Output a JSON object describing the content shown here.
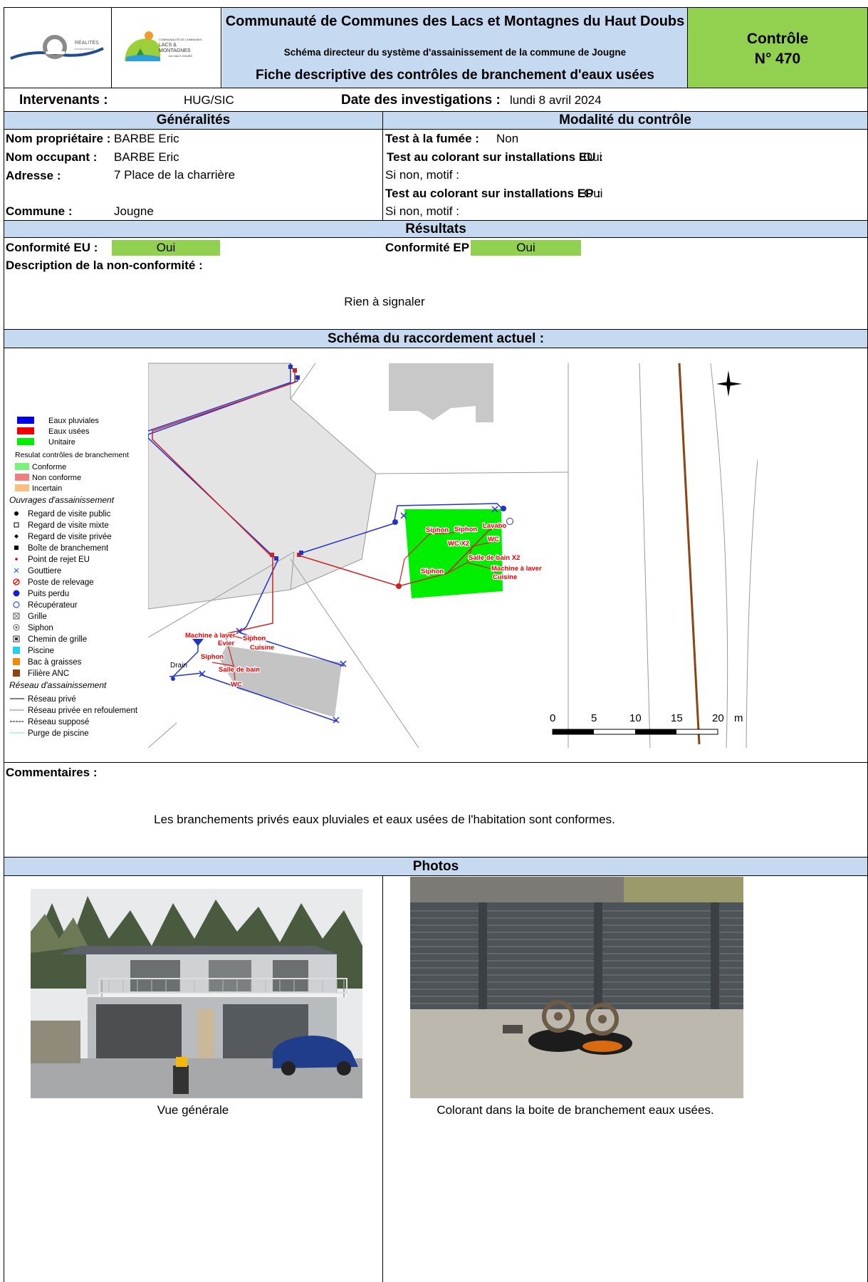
{
  "header": {
    "logo1_text": "RÉALITÉS",
    "logo1_sub": "Environnement",
    "logo2_lines": [
      "COMMUNAUTÉ DE COMMUNES",
      "LACS &",
      "MONTAGNES",
      "DU HAUT-DOUBS"
    ],
    "org_title": "Communauté de Communes des Lacs et Montagnes du Haut Doubs",
    "subtitle": "Schéma directeur du système d'assainissement de la commune de Jougne",
    "form_title": "Fiche descriptive des contrôles de branchement d'eaux usées",
    "control_label": "Contrôle",
    "control_number": "N° 470",
    "colors": {
      "blue_light": "#c5d9f1",
      "blue_bar": "#8db3e2",
      "green": "#92d050"
    }
  },
  "info": {
    "intervenants_label": "Intervenants :",
    "intervenants_value": "HUG/SIC",
    "date_label": "Date des investigations :",
    "date_value": "lundi 8 avril 2024"
  },
  "generalites": {
    "heading": "Généralités",
    "owner_label": "Nom propriétaire :",
    "owner_value": "BARBE Eric",
    "occupant_label": "Nom occupant :",
    "occupant_value": "BARBE Eric",
    "address_label": "Adresse :",
    "address_value": "7 Place de la charrière",
    "commune_label": "Commune :",
    "commune_value": "Jougne"
  },
  "modalite": {
    "heading": "Modalité du contrôle",
    "smoke_label": "Test à la fumée :",
    "smoke_value": "Non",
    "eu_dye_label": "Test au colorant sur installations EU :",
    "eu_dye_value": "Oui",
    "eu_reason_label": "Si non, motif :",
    "ep_dye_label": "Test au colorant sur installations EP :",
    "ep_dye_value": "Oui",
    "ep_reason_label": "Si non, motif :"
  },
  "resultats": {
    "heading": "Résultats",
    "eu_label": "Conformité EU :",
    "eu_value": "Oui",
    "ep_label": "Conformité EP :",
    "ep_value": "Oui",
    "nonconf_label": "Description de la non-conformité :",
    "nonconf_value": "Rien à signaler"
  },
  "schema": {
    "heading": "Schéma du raccordement actuel :",
    "legend": {
      "network_types": [
        "Eaux pluviales",
        "Eaux usées",
        "Unitaire"
      ],
      "results_title": "Resulat contrôles de branchement",
      "results": [
        "Conforme",
        "Non conforme",
        "Incertain"
      ],
      "works_title": "Ouvrages d'assainissement",
      "works": [
        "Regard de visite public",
        "Regard de visite mixte",
        "Regard de visite privée",
        "Boîte de branchement",
        "Point de rejet EU",
        "Gouttiere",
        "Poste de relevage",
        "Puits perdu",
        "Récupérateur",
        "Grille",
        "Siphon",
        "Chemin de grille",
        "Piscine",
        "Bac à graisses",
        "Filière ANC"
      ],
      "network_title": "Réseau d'assainissement",
      "networks": [
        "Réseau privé",
        "Réseau privée en refoulement",
        "Réseau supposé",
        "Purge de piscine"
      ]
    },
    "map_labels": [
      "Siphon",
      "Siphon",
      "Lavabo",
      "WC X2",
      "WC",
      "Salle de bain X2",
      "Siphon",
      "Machine à laver",
      "Cuisine",
      "Machine à laver",
      "Evier",
      "Siphon",
      "Cuisine",
      "Siphon",
      "Salle de bain",
      "WC",
      "Drain"
    ],
    "scale_ticks": [
      "0",
      "5",
      "10",
      "15",
      "20"
    ],
    "scale_unit": "m"
  },
  "comments": {
    "label": "Commentaires :",
    "text": "Les branchements privés eaux pluviales et eaux usées de l'habitation sont conformes."
  },
  "photos": {
    "heading": "Photos",
    "caption1": "Vue générale",
    "caption2": "Colorant dans la boite de branchement eaux usées."
  }
}
